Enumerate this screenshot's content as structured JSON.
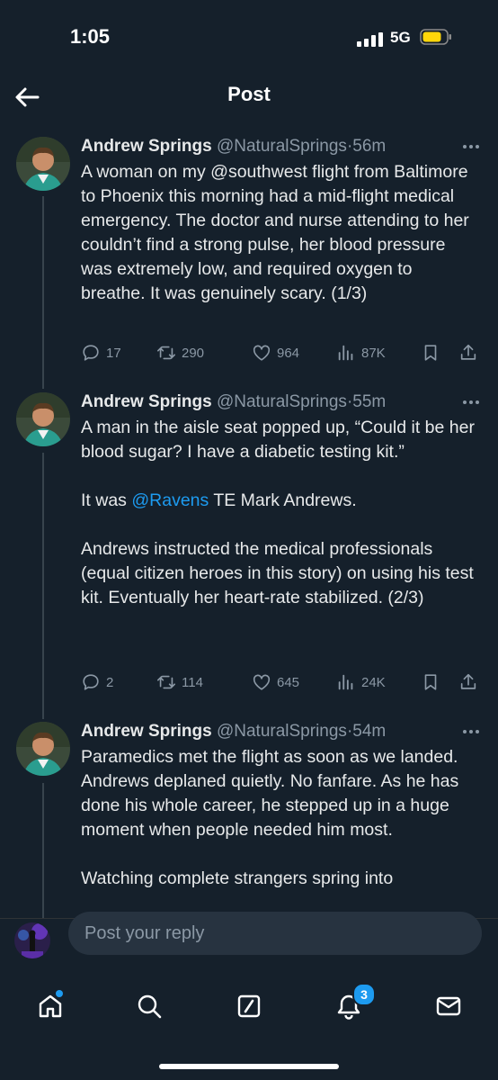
{
  "status_bar": {
    "time": "1:05",
    "network": "5G"
  },
  "header": {
    "title": "Post"
  },
  "tweets": [
    {
      "author": "Andrew Springs",
      "handle": "@NaturalSprings",
      "time": "56m",
      "text_before": "A woman on my @southwest flight from Baltimore to Phoenix this morning had a mid-flight medical emergency. The doctor and nurse attending to her couldn’t find a strong pulse, her blood pressure was extremely low, and required oxygen to breathe. It was genuinely scary. (1/3)",
      "mention": "",
      "text_after": "",
      "replies": "17",
      "reposts": "290",
      "likes": "964",
      "views": "87K"
    },
    {
      "author": "Andrew Springs",
      "handle": "@NaturalSprings",
      "time": "55m",
      "text_before": "A man in the aisle seat popped up, “Could it be her blood sugar? I have a diabetic testing kit.”\n\nIt was ",
      "mention": "@Ravens",
      "text_after": " TE Mark Andrews.\n\nAndrews instructed the medical professionals (equal citizen heroes in this story) on using his test kit. Eventually her heart-rate stabilized. (2/3)",
      "replies": "2",
      "reposts": "114",
      "likes": "645",
      "views": "24K"
    },
    {
      "author": "Andrew Springs",
      "handle": "@NaturalSprings",
      "time": "54m",
      "text_before": "Paramedics met the flight as soon as we landed. Andrews deplaned quietly. No fanfare. As he has done his whole career, he stepped up in a huge moment when people needed him most.\n\nWatching complete strangers spring into",
      "mention": "",
      "text_after": "",
      "replies": "",
      "reposts": "",
      "likes": "",
      "views": ""
    }
  ],
  "reply": {
    "placeholder": "Post your reply"
  },
  "tabs": {
    "notifications_badge": "3"
  },
  "icons": {
    "back": "arrow-left-icon",
    "more": "more-icon",
    "reply": "reply-icon",
    "repost": "repost-icon",
    "like": "heart-icon",
    "views": "views-icon",
    "bookmark": "bookmark-icon",
    "share": "share-icon",
    "home": "home-icon",
    "search": "search-icon",
    "grok": "grok-icon",
    "notifications": "bell-icon",
    "messages": "envelope-icon"
  },
  "colors": {
    "background": "#15202b",
    "accent": "#1d9bf0",
    "muted": "#8b98a5",
    "text": "#e7e9ea"
  }
}
